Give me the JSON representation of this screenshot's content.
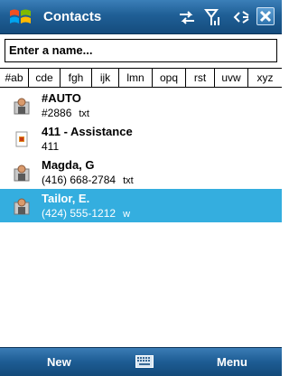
{
  "titlebar": {
    "title": "Contacts",
    "icons": [
      "start-flag-icon",
      "connectivity-arrows-icon",
      "signal-antenna-icon",
      "volume-speaker-icon",
      "close-icon"
    ],
    "close_label": "X"
  },
  "search": {
    "value": "Enter a name..."
  },
  "tabs": [
    "#ab",
    "cde",
    "fgh",
    "ijk",
    "lmn",
    "opq",
    "rst",
    "uvw",
    "xyz"
  ],
  "contacts": [
    {
      "name": "#AUTO",
      "detail": "#2886",
      "kind": "txt",
      "icon": "contact-person-icon",
      "selected": false
    },
    {
      "name": "411 - Assistance",
      "detail": "411",
      "kind": "",
      "icon": "sim-contact-icon",
      "selected": false
    },
    {
      "name": "Magda, G",
      "detail": "(416) 668-2784",
      "kind": "txt",
      "icon": "contact-person-icon",
      "selected": false
    },
    {
      "name": "Tailor, E.",
      "detail": "(424) 555-1212",
      "kind": "w",
      "icon": "contact-person-icon",
      "selected": true
    }
  ],
  "softkeys": {
    "left": "New",
    "right": "Menu",
    "center_icon": "keyboard-icon"
  },
  "colors": {
    "titlebar": "#1f5f96",
    "selection": "#34aedf"
  }
}
